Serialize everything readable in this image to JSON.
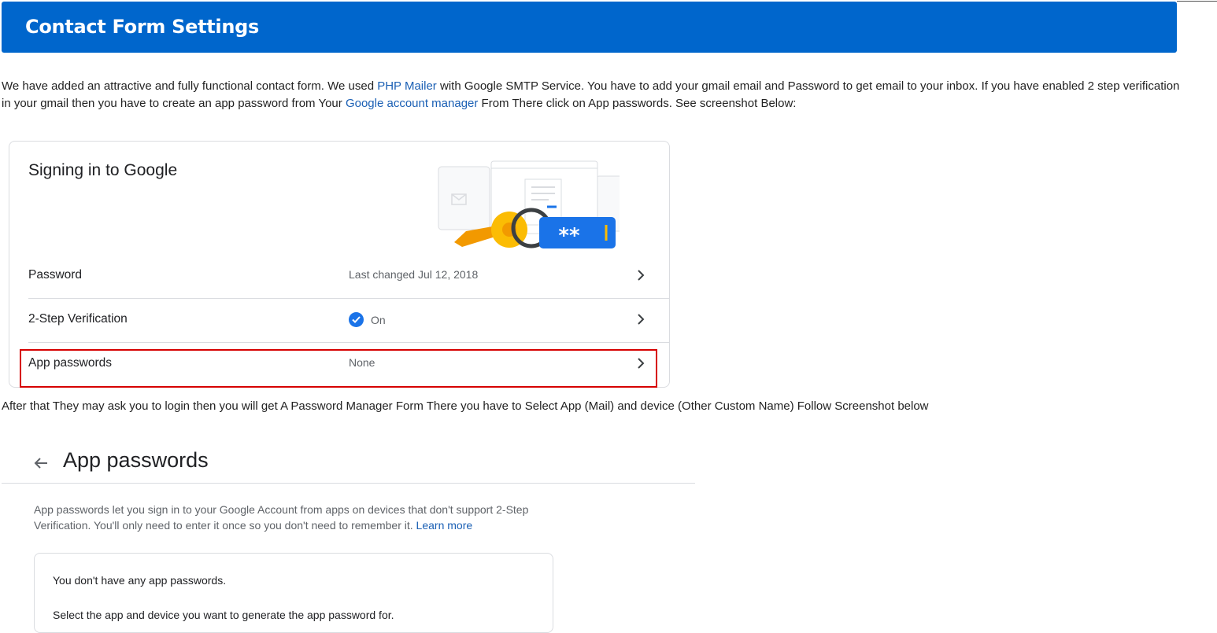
{
  "header": {
    "title": "Contact Form Settings"
  },
  "intro": {
    "text_1": "We have added an attractive and fully functional contact form. We used ",
    "link_phpmailer": "PHP Mailer",
    "text_2": " with Google SMTP Service. You have to add your gmail email and Password to get email to your inbox. If you have enabled 2 step verification in your gmail then you have to create an app password from Your ",
    "link_account": "Google account manager",
    "text_3": " From There click on App passwords. See screenshot Below:"
  },
  "signin_card": {
    "title": "Signing in to Google",
    "rows": [
      {
        "label": "Password",
        "value": "Last changed Jul 12, 2018"
      },
      {
        "label": "2-Step Verification",
        "value": "On"
      },
      {
        "label": "App passwords",
        "value": "None"
      }
    ],
    "password_mask": "**"
  },
  "after_text": "After that They may ask you to login then you will get A Password Manager Form There you have to Select App (Mail) and device (Other Custom Name) Follow Screenshot below",
  "app_passwords": {
    "title": "App passwords",
    "desc_1": "App passwords let you sign in to your Google Account from apps on devices that don't support 2-Step Verification. You'll only need to enter it once so you don't need to remember it. ",
    "learn_more": "Learn more",
    "none_text": "You don't have any app passwords.",
    "select_text": "Select the app and device you want to generate the app password for."
  },
  "colors": {
    "header_bg": "#0066cc",
    "link": "#1a5fb4",
    "highlight": "#d60000",
    "check": "#1a73e8"
  }
}
